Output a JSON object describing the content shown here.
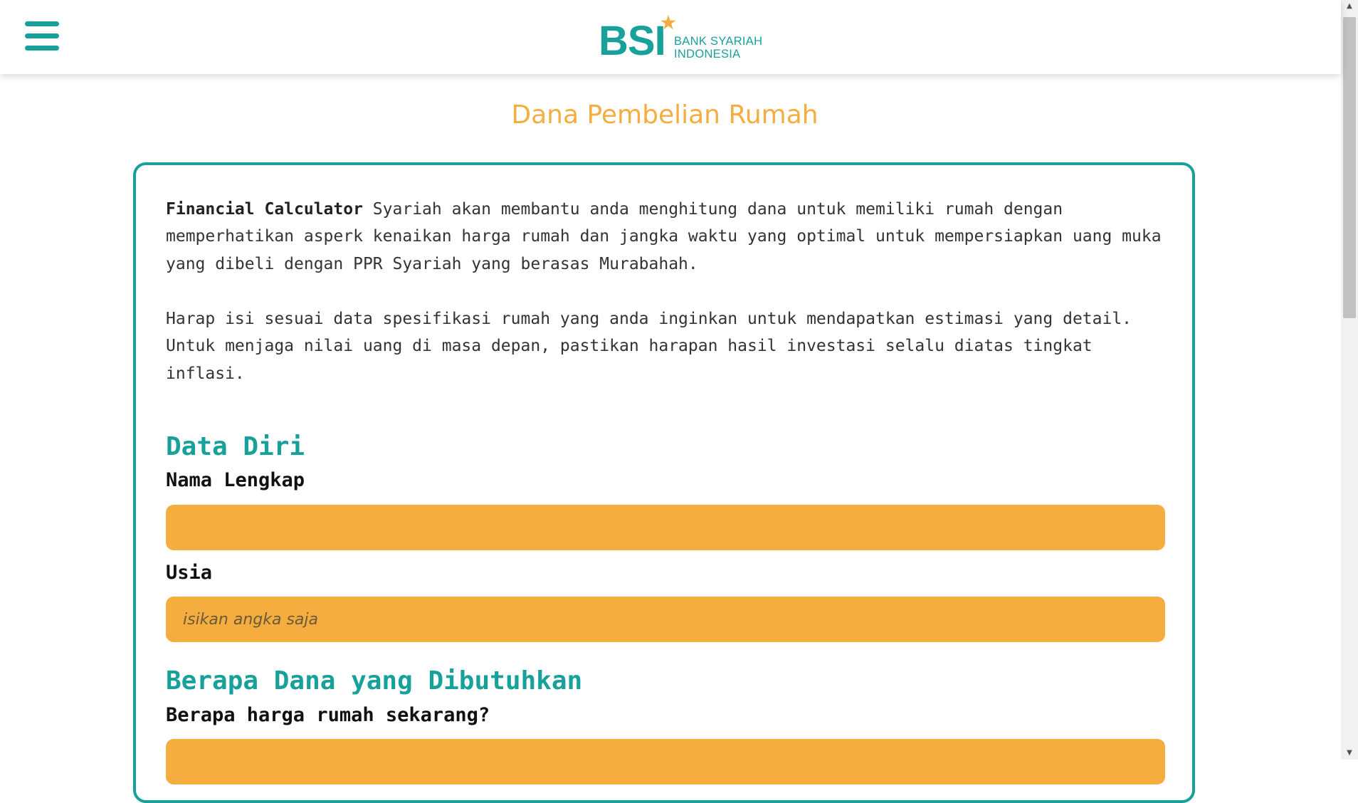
{
  "header": {
    "menu_icon": "hamburger-menu-icon",
    "logo": {
      "mark": "BSI",
      "line1": "BANK SYARIAH",
      "line2": "INDONESIA"
    }
  },
  "page": {
    "title": "Dana Pembelian Rumah"
  },
  "intro": {
    "bold": "Financial Calculator",
    "text1": " Syariah akan membantu anda menghitung dana untuk memiliki rumah dengan memperhatikan asperk kenaikan harga rumah dan jangka waktu yang optimal untuk mempersiapkan uang muka yang dibeli dengan PPR Syariah yang berasas Murabahah.",
    "text2": "Harap isi sesuai data spesifikasi rumah yang anda inginkan untuk mendapatkan estimasi yang detail. Untuk menjaga nilai uang di masa depan, pastikan harapan hasil investasi selalu diatas tingkat inflasi."
  },
  "sections": {
    "data_diri": {
      "title": "Data Diri",
      "nama_label": "Nama Lengkap",
      "nama_value": "",
      "usia_label": "Usia",
      "usia_placeholder": "isikan angka saja"
    },
    "dana": {
      "title": "Berapa Dana yang Dibutuhkan",
      "harga_label": "Berapa harga rumah sekarang?",
      "harga_value": ""
    }
  },
  "colors": {
    "primary": "#18a19b",
    "accent": "#f6ad3f"
  }
}
